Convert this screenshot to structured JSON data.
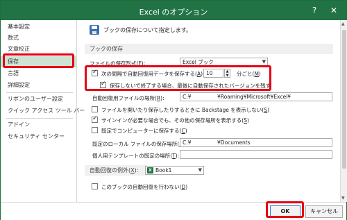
{
  "window": {
    "title": "Excel のオプション",
    "help_glyph": "?",
    "close_glyph": "✕"
  },
  "sidebar": {
    "items": [
      {
        "label": "基本設定"
      },
      {
        "label": "数式"
      },
      {
        "label": "文章校正"
      },
      {
        "label": "保存",
        "selected": true
      },
      {
        "label": "言語"
      },
      {
        "label": "詳細設定"
      },
      {
        "label": "リボンのユーザー設定"
      },
      {
        "label": "クイック アクセス ツール バー"
      },
      {
        "label": "アドイン"
      },
      {
        "label": "セキュリティ センター"
      }
    ]
  },
  "main": {
    "header_text": "ブックの保存について指定します。",
    "section_save": "ブックの保存",
    "file_format": {
      "label": "ファイルの保存形式(",
      "key": "F",
      "label_end": "):",
      "value": "Excel ブック"
    },
    "autorecover": {
      "label": "次の間隔で自動回復用データを保存する(",
      "key": "A",
      "label_end": "):",
      "checked": true,
      "minutes": "10",
      "unit_label": "分ごと(",
      "unit_key": "M",
      "unit_end": ")"
    },
    "keep_last": {
      "label": "保存しないで終了する場合、最後に自動保存されたバージョンを残す",
      "checked": true
    },
    "autorecover_location": {
      "label": "自動回復用ファイルの場所(",
      "key": "R",
      "label_end": "):",
      "value": "C:¥　　　　　¥Roaming¥Microsoft¥Excel¥"
    },
    "backstage": {
      "label": "ファイルを開いたり保存したりするときに Backstage を表示しない(",
      "key": "S",
      "label_end": ")",
      "checked": false
    },
    "sign_in": {
      "label": "サインインが必要な場合でも、その他の保存場所を表示する(",
      "key": "S",
      "label_end": ")",
      "checked": true
    },
    "default_computer": {
      "label": "既定でコンピューターに保存する(",
      "key": "C",
      "label_end": ")",
      "checked": false
    },
    "default_local": {
      "label": "既定のローカル ファイルの保存場所(",
      "key": "I",
      "label_end": "):",
      "value": "C:¥　　　　　¥Documents"
    },
    "personal_templates": {
      "label": "個人用テンプレートの既定の場所(",
      "key": "T",
      "label_end": "):",
      "value": ""
    },
    "exceptions": {
      "label": "自動回復の例外(",
      "key": "X",
      "label_end": "):",
      "workbook": "Book1",
      "icon_letter": "X"
    },
    "disable_autorecover": {
      "label": "このブックの自動回復を行わない(",
      "key": "D",
      "label_end": ")",
      "checked": false
    }
  },
  "footer": {
    "ok_label": "OK",
    "cancel_label": "キャンセル"
  }
}
